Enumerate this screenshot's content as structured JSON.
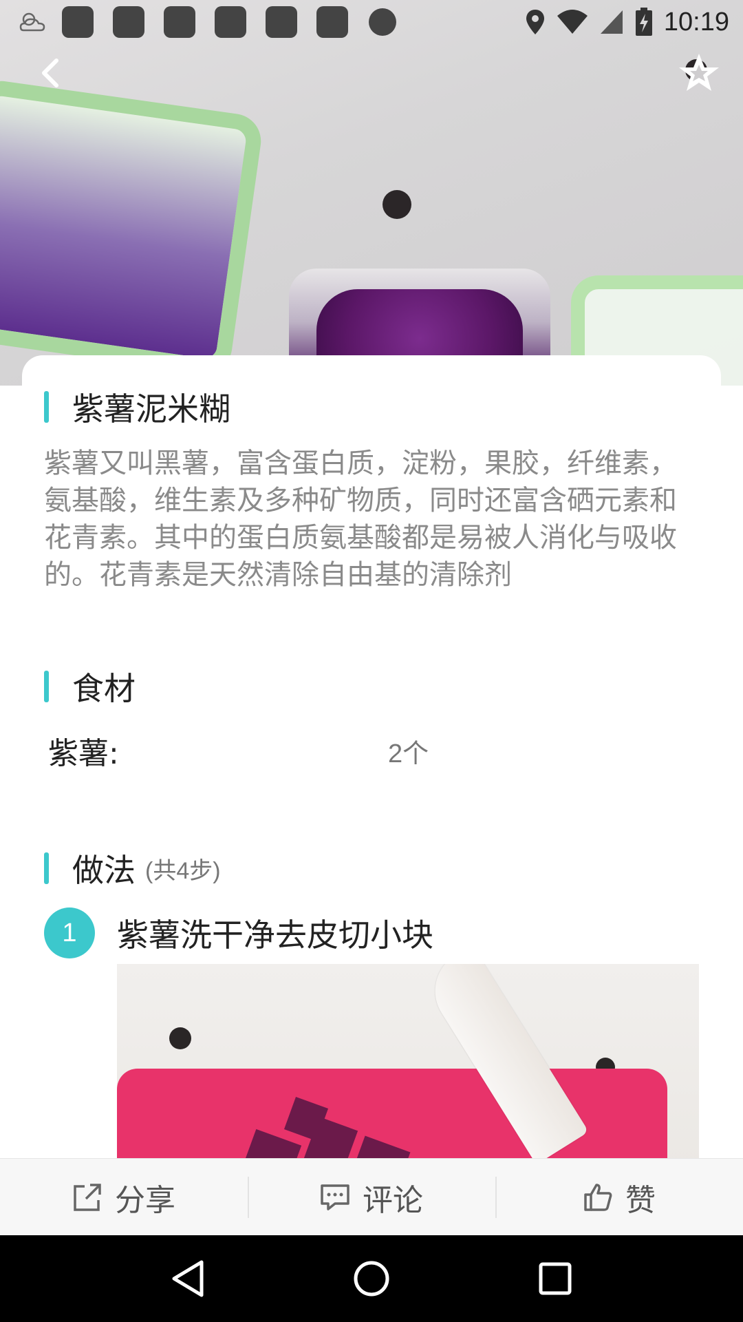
{
  "status_bar": {
    "time": "10:19",
    "icons": [
      "weather-cloudy-icon",
      "notification-icon",
      "location-icon",
      "wifi-icon",
      "signal-icon",
      "battery-charging-icon"
    ]
  },
  "header": {
    "back_icon": "chevron-left-icon",
    "favorite_icon": "star-icon"
  },
  "recipe": {
    "title": "紫薯泥米糊",
    "description": "紫薯又叫黑薯，富含蛋白质，淀粉，果胶，纤维素，氨基酸，维生素及多种矿物质，同时还富含硒元素和花青素。其中的蛋白质氨基酸都是易被人消化与吸收的。花青素是天然清除自由基的清除剂"
  },
  "ingredients": {
    "heading": "食材",
    "items": [
      {
        "name": "紫薯:",
        "quantity": "2个"
      }
    ]
  },
  "method": {
    "heading": "做法",
    "count_label": "(共4步)",
    "steps": [
      {
        "number": "1",
        "text": "紫薯洗干净去皮切小块"
      }
    ]
  },
  "actions": {
    "share_label": "分享",
    "comment_label": "评论",
    "like_label": "赞"
  },
  "colors": {
    "accent": "#3cc8cc",
    "title_text": "#222222",
    "body_text": "#8a8a8a",
    "action_bar_bg": "#f7f7f7"
  }
}
